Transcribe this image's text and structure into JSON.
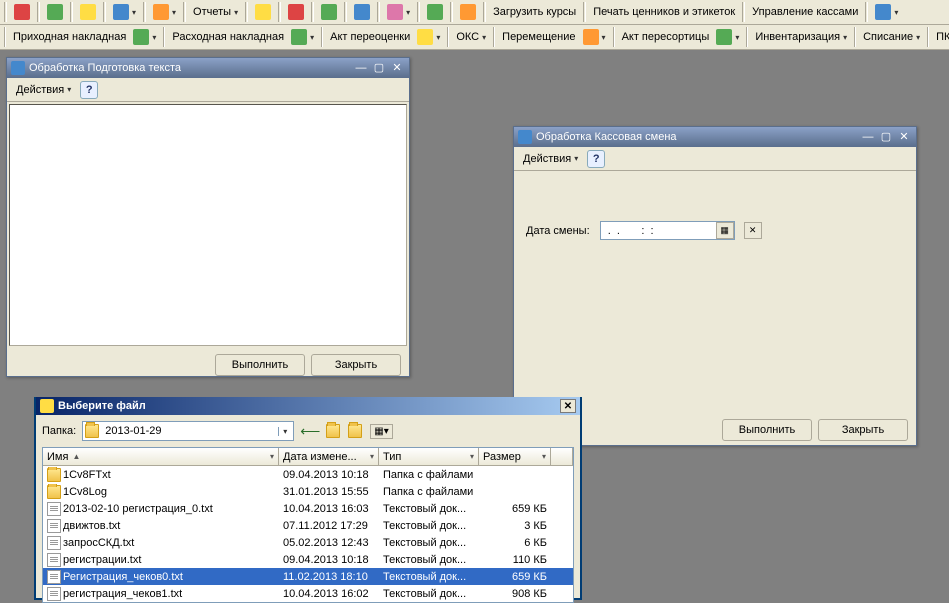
{
  "toolbar1": {
    "reports": "Отчеты",
    "load_rates": "Загрузить курсы",
    "print_tags": "Печать ценников и этикеток",
    "cash_mgmt": "Управление кассами"
  },
  "toolbar2": {
    "in_invoice": "Приходная накладная",
    "out_invoice": "Расходная накладная",
    "revaluation": "Акт переоценки",
    "oks": "ОКС",
    "move": "Перемещение",
    "resort": "Акт пересортицы",
    "inventory": "Инвентаризация",
    "writeoff": "Списание",
    "pko": "ПКО"
  },
  "win1": {
    "title": "Обработка  Подготовка текста",
    "actions": "Действия",
    "run": "Выполнить",
    "close": "Закрыть"
  },
  "win2": {
    "title": "Обработка  Кассовая смена",
    "actions": "Действия",
    "date_label": "Дата смены:",
    "date_value": " .  .       :  : ",
    "run": "Выполнить",
    "close": "Закрыть"
  },
  "dlg": {
    "title": "Выберите файл",
    "folder_label": "Папка:",
    "folder_value": "2013-01-29",
    "cols": {
      "name": "Имя",
      "date": "Дата измене...",
      "type": "Тип",
      "size": "Размер"
    },
    "files": [
      {
        "name": "1Cv8FTxt",
        "date": "09.04.2013 10:18",
        "type": "Папка с файлами",
        "size": "",
        "kind": "folder"
      },
      {
        "name": "1Cv8Log",
        "date": "31.01.2013 15:55",
        "type": "Папка с файлами",
        "size": "",
        "kind": "folder"
      },
      {
        "name": "2013-02-10 регистрация_0.txt",
        "date": "10.04.2013 16:03",
        "type": "Текстовый док...",
        "size": "659 КБ",
        "kind": "txt"
      },
      {
        "name": "движтов.txt",
        "date": "07.11.2012 17:29",
        "type": "Текстовый док...",
        "size": "3 КБ",
        "kind": "txt"
      },
      {
        "name": "запросСКД.txt",
        "date": "05.02.2013 12:43",
        "type": "Текстовый док...",
        "size": "6 КБ",
        "kind": "txt"
      },
      {
        "name": "регистрации.txt",
        "date": "09.04.2013 10:18",
        "type": "Текстовый док...",
        "size": "110 КБ",
        "kind": "txt"
      },
      {
        "name": "Регистрация_чеков0.txt",
        "date": "11.02.2013 18:10",
        "type": "Текстовый док...",
        "size": "659 КБ",
        "kind": "txt",
        "selected": true
      },
      {
        "name": "регистрация_чеков1.txt",
        "date": "10.04.2013 16:02",
        "type": "Текстовый док...",
        "size": "908 КБ",
        "kind": "txt"
      }
    ]
  }
}
